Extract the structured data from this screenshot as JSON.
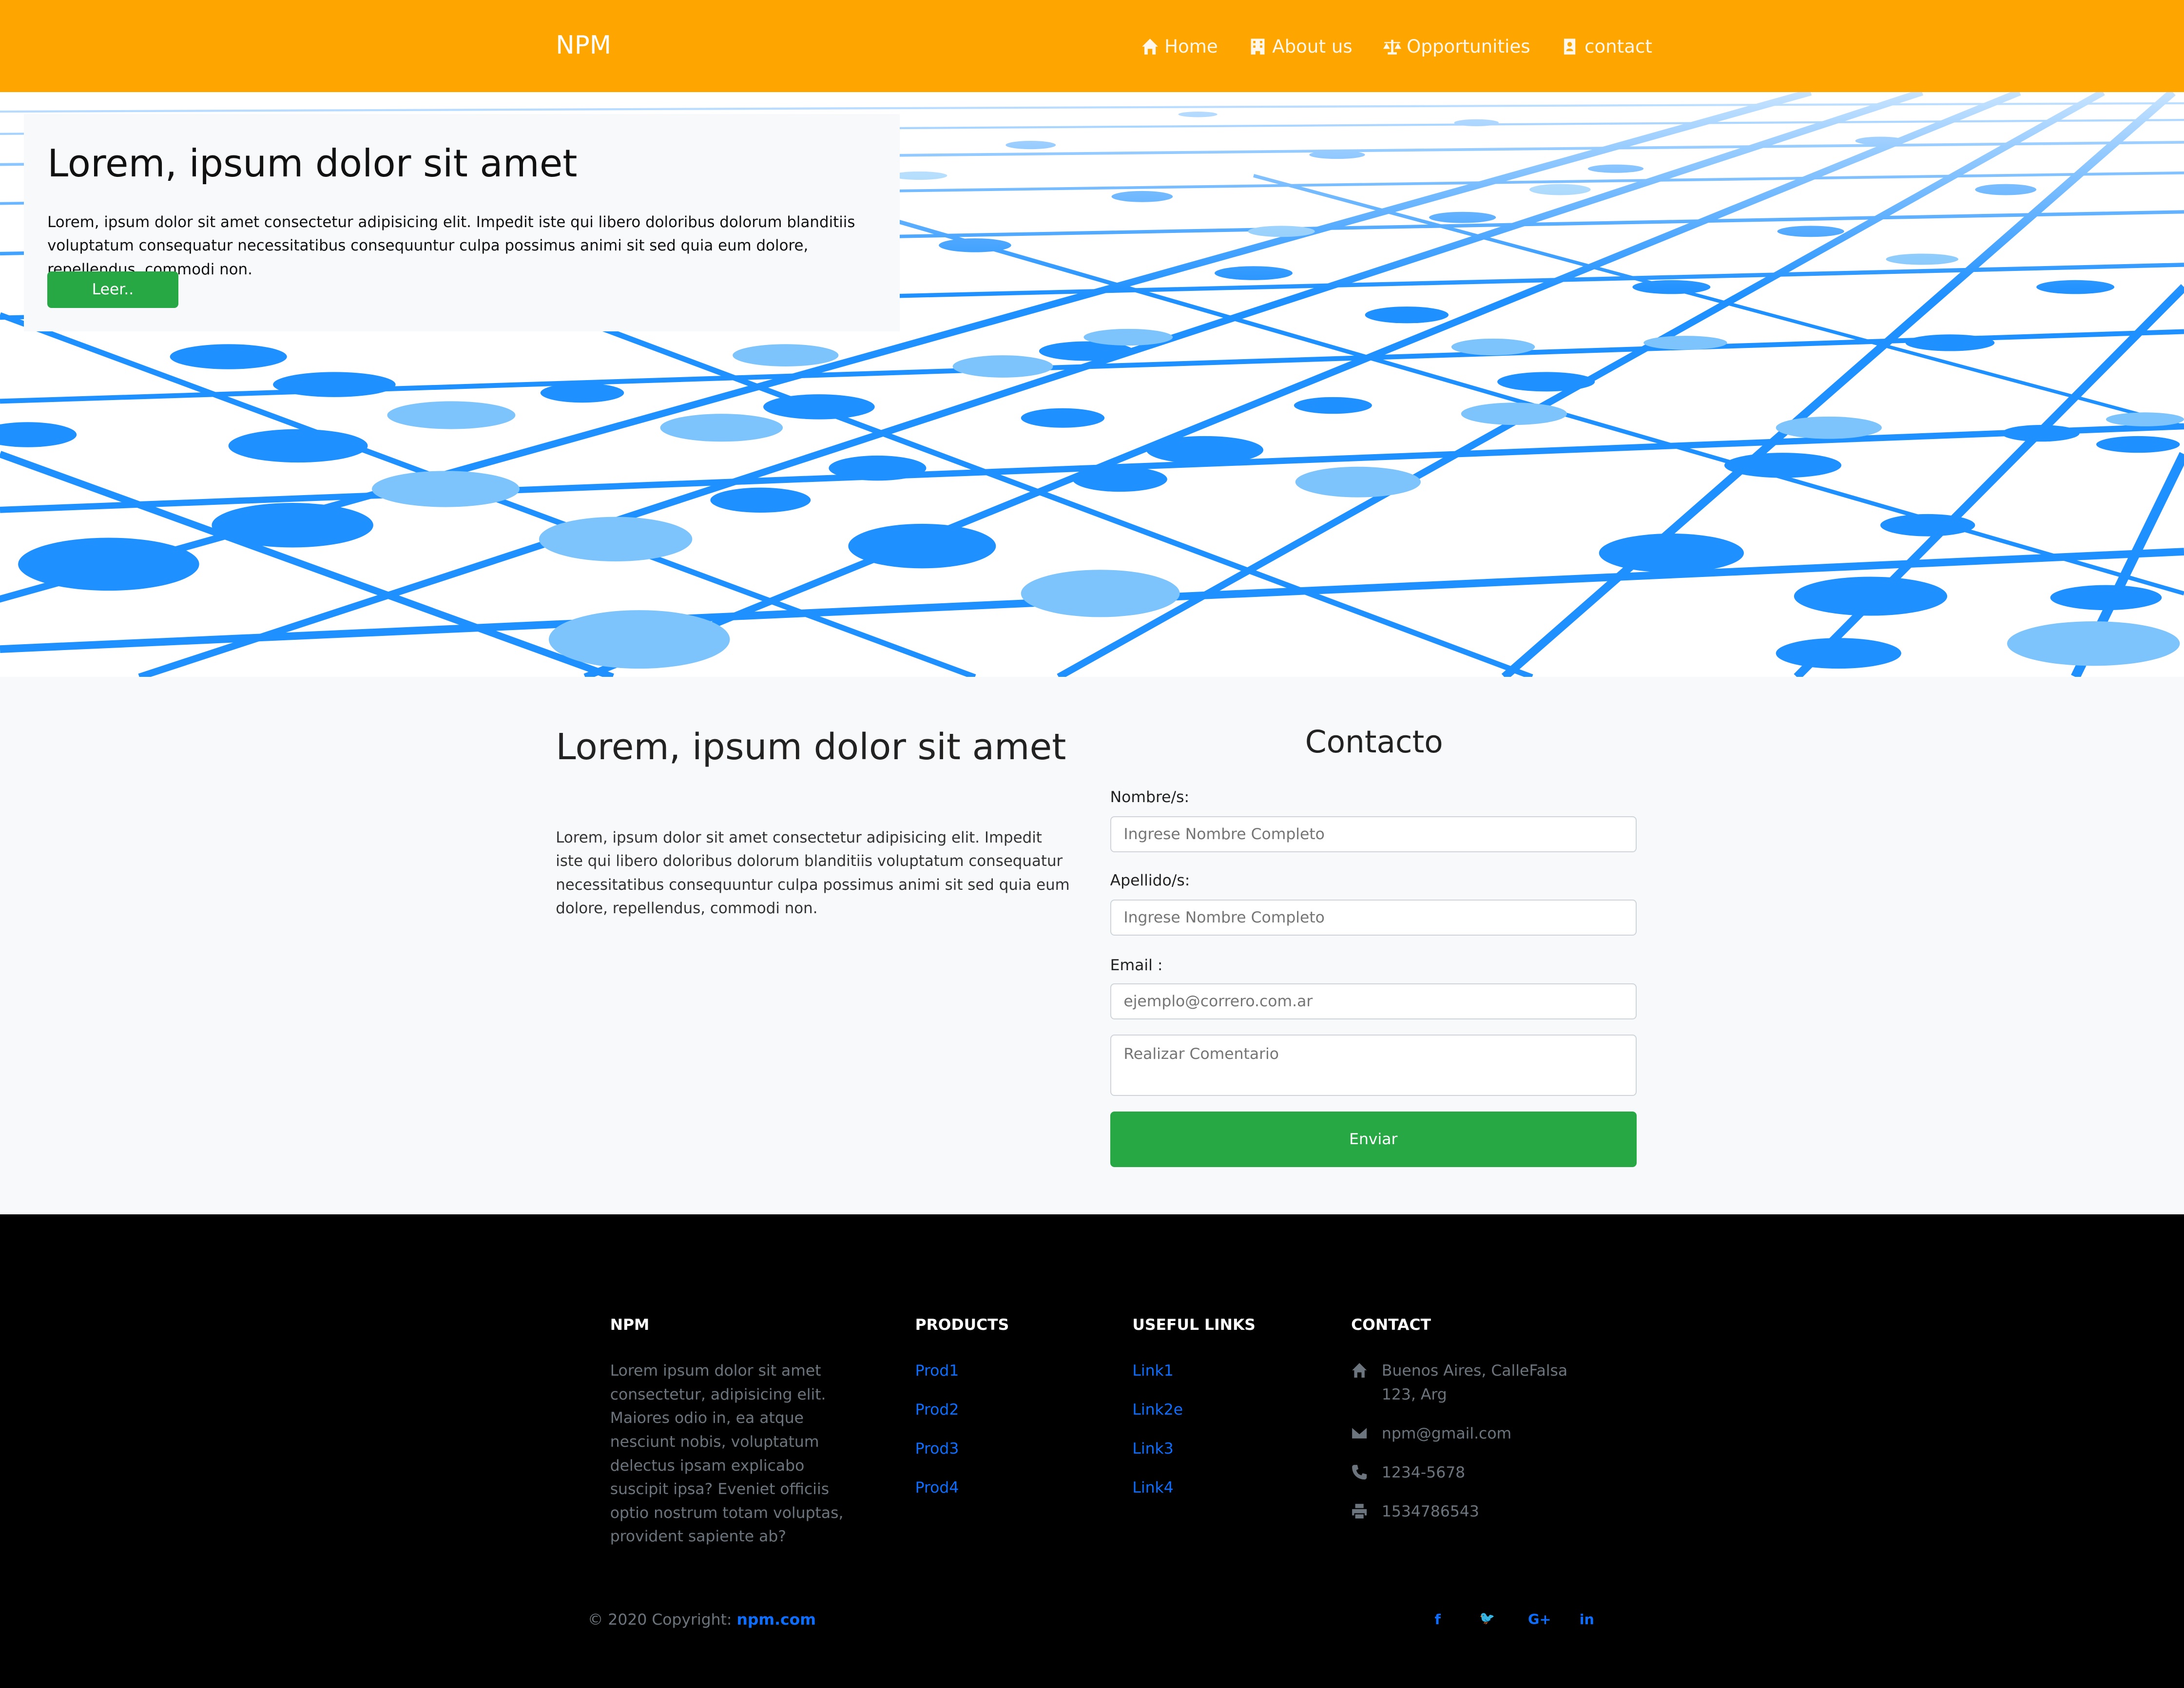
{
  "navbar": {
    "brand": "NPM",
    "items": [
      {
        "label": "Home",
        "icon": "home-icon"
      },
      {
        "label": "About us",
        "icon": "building-icon"
      },
      {
        "label": "Opportunities",
        "icon": "balance-scale-icon"
      },
      {
        "label": "contact",
        "icon": "address-book-icon"
      }
    ]
  },
  "hero": {
    "title": "Lorem, ipsum dolor sit amet",
    "text": "Lorem, ipsum dolor sit amet consectetur adipisicing elit. Impedit iste qui libero doloribus dolorum blanditiis voluptatum consequatur necessitatibus consequuntur culpa possimus animi sit sed quia eum dolore, repellendus, commodi non.",
    "button": "Leer..",
    "colors": {
      "grid": "#1e90ff",
      "light_node": "#7cc4fb"
    }
  },
  "main": {
    "title": "Lorem, ipsum dolor sit amet",
    "text": "Lorem, ipsum dolor sit amet consectetur adipisicing elit. Impedit iste qui libero doloribus dolorum blanditiis voluptatum consequatur necessitatibus consequuntur culpa possimus animi sit sed quia eum dolore, repellendus, commodi non."
  },
  "contact_form": {
    "title": "Contacto",
    "name_label": "Nombre/s:",
    "name_placeholder": "Ingrese Nombre Completo",
    "lastname_label": "Apellido/s:",
    "lastname_placeholder": "Ingrese Nombre Completo",
    "email_label": "Email :",
    "email_placeholder": "ejemplo@correro.com.ar",
    "comment_placeholder": "Realizar Comentario",
    "submit": "Enviar"
  },
  "footer": {
    "about_heading": "NPM",
    "about_text": "Lorem ipsum dolor sit amet consectetur, adipisicing elit. Maiores odio in, ea atque nesciunt nobis, voluptatum delectus ipsam explicabo suscipit ipsa? Eveniet officiis optio nostrum totam voluptas, provident sapiente ab?",
    "products_heading": "PRODUCTS",
    "products": [
      "Prod1",
      "Prod2",
      "Prod3",
      "Prod4"
    ],
    "links_heading": "USEFUL LINKS",
    "links": [
      "Link1",
      "Link2e",
      "Link3",
      "Link4"
    ],
    "contact_heading": "CONTACT",
    "address": "Buenos Aires, CalleFalsa 123, Arg",
    "email": "npm@gmail.com",
    "phone": "1234-5678",
    "fax": "1534786543",
    "copyright_prefix": "© 2020 Copyright:",
    "copyright_link": "npm.com",
    "social": [
      {
        "label": "f",
        "icon": "facebook-icon"
      },
      {
        "label": "🐦",
        "icon": "twitter-icon"
      },
      {
        "label": "G+",
        "icon": "google-plus-icon"
      },
      {
        "label": "in",
        "icon": "linkedin-icon"
      }
    ]
  }
}
